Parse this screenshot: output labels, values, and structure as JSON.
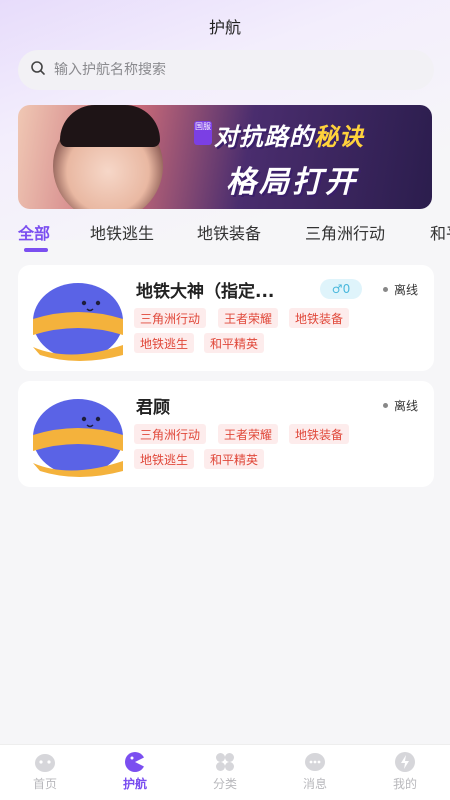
{
  "page": {
    "title": "护航"
  },
  "search": {
    "placeholder": "输入护航名称搜索",
    "icon": "search-icon"
  },
  "banner": {
    "badge": "国服",
    "line1_prefix": "对抗路的",
    "line1_highlight": "秘诀",
    "line2": "格局打开"
  },
  "tabs": [
    "全部",
    "地铁逃生",
    "地铁装备",
    "三角洲行动",
    "和平精英"
  ],
  "active_tab": 0,
  "escorts": [
    {
      "name": "地铁大神（指定...",
      "gender_count": "0",
      "status": "离线",
      "tags": [
        "三角洲行动",
        "王者荣耀",
        "地铁装备",
        "地铁逃生",
        "和平精英"
      ]
    },
    {
      "name": "君顾",
      "status": "离线",
      "tags": [
        "三角洲行动",
        "王者荣耀",
        "地铁装备",
        "地铁逃生",
        "和平精英"
      ]
    }
  ],
  "tabbar": [
    {
      "label": "首页",
      "icon": "home-icon"
    },
    {
      "label": "护航",
      "icon": "escort-icon"
    },
    {
      "label": "分类",
      "icon": "category-icon"
    },
    {
      "label": "消息",
      "icon": "message-icon"
    },
    {
      "label": "我的",
      "icon": "profile-icon"
    }
  ],
  "colors": {
    "accent": "#7b4ff0",
    "tag_bg": "#fdecec",
    "tag_text": "#e0483a",
    "gender": "#4ab8dc"
  }
}
